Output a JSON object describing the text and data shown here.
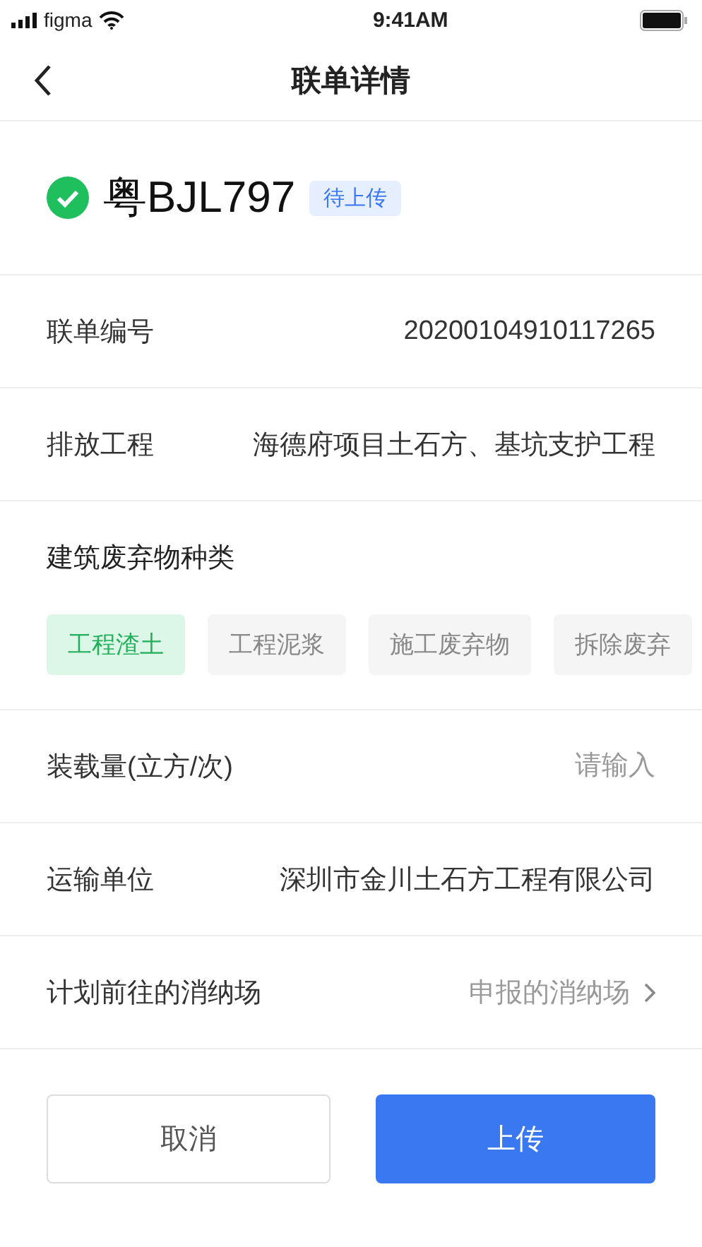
{
  "status_bar": {
    "carrier": "figma",
    "time": "9:41AM"
  },
  "nav": {
    "title": "联单详情"
  },
  "vehicle": {
    "plate": "粤BJL797",
    "verified": true,
    "status": "待上传"
  },
  "fields": [
    {
      "kind": "text",
      "label": "联单编号",
      "value": "20200104910117265"
    },
    {
      "kind": "text",
      "label": "排放工程",
      "value": "海德府项目土石方、基坑支护工程"
    }
  ],
  "waste_types": {
    "label": "建筑废弃物种类",
    "options": [
      {
        "label": "工程渣土",
        "selected": true
      },
      {
        "label": "工程泥浆",
        "selected": false
      },
      {
        "label": "施工废弃物",
        "selected": false
      },
      {
        "label": "拆除废弃",
        "selected": false
      }
    ]
  },
  "fields_2": [
    {
      "kind": "input",
      "label": "装载量(立方/次)",
      "placeholder": "请输入"
    },
    {
      "kind": "text",
      "label": "运输单位",
      "value": "深圳市金川土石方工程有限公司"
    },
    {
      "kind": "select",
      "label": "计划前往的消纳场",
      "value": "申报的消纳场"
    }
  ],
  "buttons": [
    {
      "kind": "secondary",
      "label": "取消"
    },
    {
      "kind": "primary",
      "label": "上传"
    }
  ]
}
